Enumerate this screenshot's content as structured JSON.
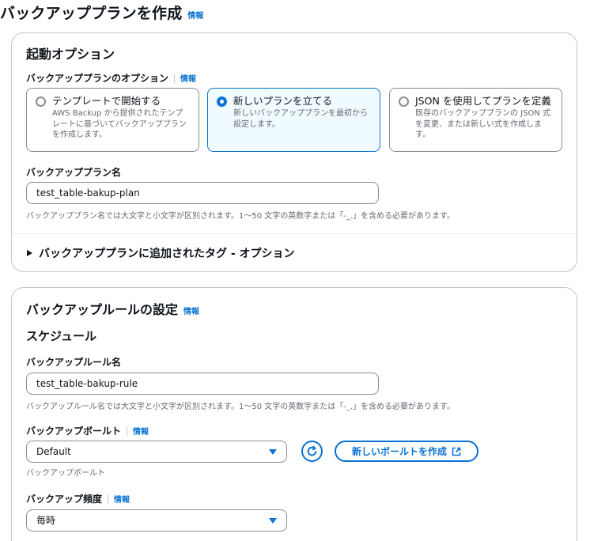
{
  "page": {
    "title": "バックアッププランを作成",
    "info": "情報"
  },
  "launch": {
    "heading": "起動オプション",
    "options_label": "バックアッププランのオプション",
    "options_info": "情報",
    "tiles": [
      {
        "title": "テンプレートで開始する",
        "desc": "AWS Backup から提供されたテンプレートに基づいてバックアッププランを作成します。",
        "selected": false
      },
      {
        "title": "新しいプランを立てる",
        "desc": "新しいバックアッププランを最初から設定します。",
        "selected": true
      },
      {
        "title": "JSON を使用してプランを定義",
        "desc": "既存のバックアッププランの JSON 式を変更、または新しい式を作成します。",
        "selected": false
      }
    ],
    "plan_name_label": "バックアッププラン名",
    "plan_name_value": "test_table-bakup-plan",
    "plan_name_hint": "バックアッププラン名では大文字と小文字が区別されます。1～50 文字の英数字または「-_.」を含める必要があります。",
    "tags_expander": "バックアッププランに追加されたタグ - オプション"
  },
  "rule": {
    "heading": "バックアップルールの設定",
    "info": "情報",
    "schedule_heading": "スケジュール",
    "rule_name_label": "バックアップルール名",
    "rule_name_value": "test_table-bakup-rule",
    "rule_name_hint": "バックアップルール名では大文字と小文字が区別されます。1～50 文字の英数字または「-_.」を含める必要があります。",
    "vault_label": "バックアップボールト",
    "vault_info": "情報",
    "vault_value": "Default",
    "vault_hint": "バックアップボールト",
    "create_vault_button": "新しいボールトを作成",
    "frequency_label": "バックアップ頻度",
    "frequency_info": "情報",
    "frequency_value": "毎時"
  },
  "colors": {
    "accent": "#0972d3",
    "selected_bg": "#f0fbff",
    "border": "#8c8c94",
    "hint": "#656871"
  },
  "icons": [
    "refresh-icon",
    "external-link-icon",
    "caret-right-icon",
    "chevron-down-icon"
  ]
}
